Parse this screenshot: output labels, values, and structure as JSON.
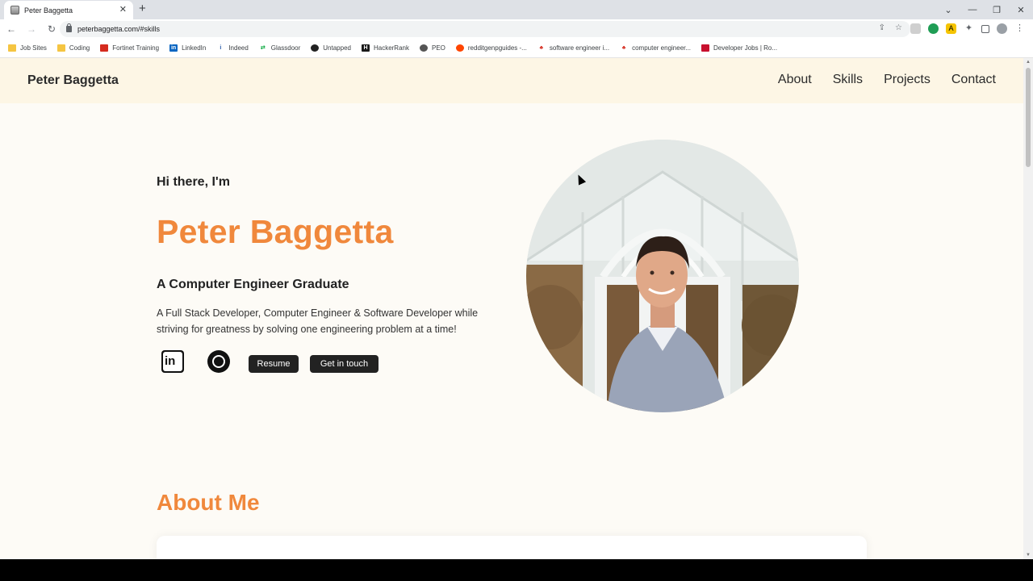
{
  "browser": {
    "tab_title": "Peter Baggetta",
    "new_tab": "+",
    "tab_close": "✕",
    "url": "peterbaggetta.com/#skills",
    "window_controls": [
      "⌄",
      "—",
      "❐",
      "✕"
    ],
    "bookmarks": [
      {
        "label": "Job Sites",
        "icon": "folder-icon"
      },
      {
        "label": "Coding",
        "icon": "folder-icon"
      },
      {
        "label": "Fortinet Training",
        "icon": "fortinet-icon"
      },
      {
        "label": "LinkedIn",
        "icon": "linkedin-icon"
      },
      {
        "label": "Indeed",
        "icon": "indeed-icon"
      },
      {
        "label": "Glassdoor",
        "icon": "glassdoor-icon"
      },
      {
        "label": "Untapped",
        "icon": "untapped-icon"
      },
      {
        "label": "HackerRank",
        "icon": "hackerrank-icon"
      },
      {
        "label": "PEO",
        "icon": "globe-icon"
      },
      {
        "label": "redditgenpguides -...",
        "icon": "reddit-icon"
      },
      {
        "label": "software engineer i...",
        "icon": "maple-leaf-icon"
      },
      {
        "label": "computer engineer...",
        "icon": "maple-leaf-icon"
      },
      {
        "label": "Developer Jobs | Ro...",
        "icon": "jobs-icon"
      }
    ]
  },
  "site": {
    "logo": "Peter Baggetta",
    "nav": [
      "About",
      "Skills",
      "Projects",
      "Contact"
    ],
    "hero": {
      "greeting": "Hi there, I'm",
      "name": "Peter Baggetta",
      "subtitle": "A Computer Engineer Graduate",
      "description": "A Full Stack Developer, Computer Engineer & Software Developer while striving for greatness by solving one engineering problem at a time!",
      "resume_label": "Resume",
      "contact_label": "Get in touch"
    },
    "about_title": "About Me"
  },
  "colors": {
    "accent": "#f0883c",
    "header_bg": "#fdf6e5",
    "page_bg": "#fdfbf6"
  }
}
